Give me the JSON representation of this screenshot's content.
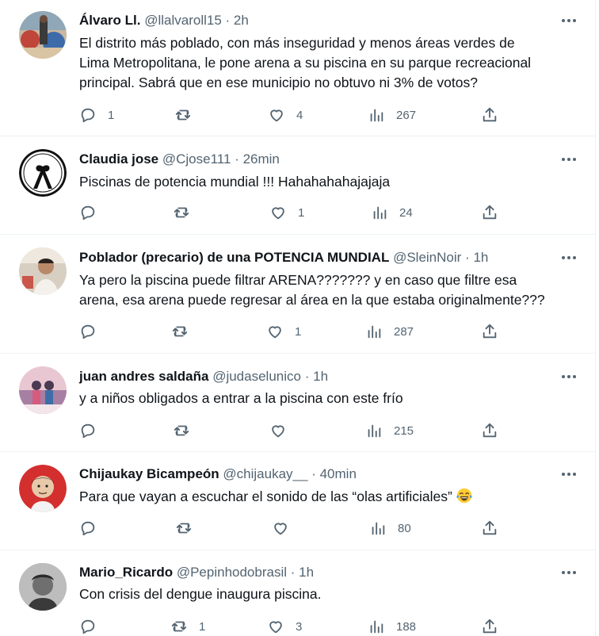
{
  "colors": {
    "text": "#0f1419",
    "muted": "#536471",
    "border": "#eff3f4"
  },
  "tweets": [
    {
      "name": "Álvaro Ll.",
      "handle": "@llalvaroll15",
      "separator": "·",
      "time": "2h",
      "lines": [
        "El distrito más poblado, con más inseguridad y menos áreas verdes de",
        "Lima Metropolitana, le pone arena a su piscina en su parque recreacional",
        "principal. Sabrá que en ese municipio no obtuvo ni 3% de votos?"
      ],
      "replies": "1",
      "retweets": "",
      "likes": "4",
      "views": "267"
    },
    {
      "name": "Claudia jose",
      "handle": "@Cjose111",
      "separator": "·",
      "time": "26min",
      "lines": [
        "Piscinas de potencia mundial !!! Hahahahahajajaja"
      ],
      "replies": "",
      "retweets": "",
      "likes": "1",
      "views": "24"
    },
    {
      "name": "Poblador (precario) de una POTENCIA MUNDIAL",
      "handle": "@SleinNoir",
      "separator": "·",
      "time": "1h",
      "lines": [
        "Ya pero la piscina puede filtrar ARENA??????? y en caso que filtre esa",
        "arena, esa arena puede regresar al área en la que estaba originalmente???"
      ],
      "replies": "",
      "retweets": "",
      "likes": "1",
      "views": "287"
    },
    {
      "name": "juan andres saldaña",
      "handle": "@judaselunico",
      "separator": "·",
      "time": "1h",
      "lines": [
        "y a niños obligados a entrar a la piscina con este frío"
      ],
      "replies": "",
      "retweets": "",
      "likes": "",
      "views": "215"
    },
    {
      "name": "Chijaukay Bicampeón",
      "handle": "@chijaukay__",
      "separator": "·",
      "time": "40min",
      "lines": [
        "Para que vayan a escuchar el sonido de las “olas artificiales”"
      ],
      "emoji": "face-with-tears-of-joy",
      "replies": "",
      "retweets": "",
      "likes": "",
      "views": "80"
    },
    {
      "name": "Mario_Ricardo",
      "handle": "@Pepinhodobrasil",
      "separator": "·",
      "time": "1h",
      "lines": [
        "Con crisis del dengue inaugura piscina."
      ],
      "replies": "",
      "retweets": "1",
      "likes": "3",
      "views": "188"
    }
  ],
  "icons": {
    "more": "more-icon",
    "reply": "reply-icon",
    "retweet": "retweet-icon",
    "like": "heart-icon",
    "views": "views-icon",
    "share": "share-icon"
  }
}
